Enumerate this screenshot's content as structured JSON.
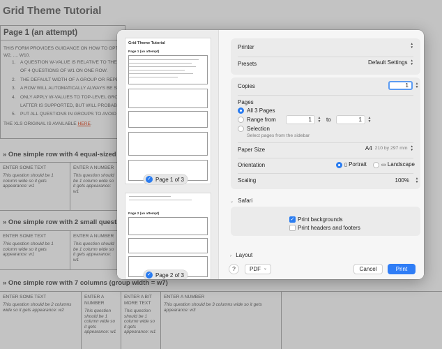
{
  "background": {
    "title": "Grid Theme Tutorial",
    "group_title": "Page 1 (an attempt)",
    "intro": "THIS FORM PROVIDES GUIDANCE ON HOW TO OPTI",
    "intro2": "W2, .... W10.",
    "list": [
      "A QUESTION W-VALUE IS RELATIVE TO THE W",
      "OF 4 QUESTIONS OF W1 ON ONE ROW.",
      "THE DEFAULT WIDTH OF A GROUP OR REPE",
      "A ROW WILL AUTOMATICALLY ALWAYS BE ST",
      "ONLY APPLY W-VALUES TO TOP-LEVEL GRO",
      "LATTER IS SUPPORTED, BUT WILL PROBABLY",
      "PUT ALL QUESTIONS IN GROUPS TO AVOID L"
    ],
    "list_numbers": [
      "1.",
      "",
      "2.",
      "3.",
      "4.",
      "",
      "5."
    ],
    "xls_prefix": "THE XLS ORIGINAL IS AVAILABLE",
    "xls_link": "HERE",
    "xls_suffix": ".",
    "sections": [
      {
        "heading": "» One simple row with 4 equal-sized que",
        "cells": [
          {
            "label": "ENTER SOME TEXT",
            "hint": "This question should be 1 column wide so it gets appearance: w1"
          },
          {
            "label": "ENTER A NUMBER",
            "hint": "This question should be 1 column wide so it gets appearance: w1"
          }
        ]
      },
      {
        "heading": "» One simple row with 2 small questions",
        "cells": [
          {
            "label": "ENTER SOME TEXT",
            "hint": "This question should be 1 column wide so it gets appearance: w1"
          },
          {
            "label": "ENTER A NUMBER",
            "hint": "This question should be 1 column wide so it gets appearance: w1"
          }
        ]
      },
      {
        "heading": "» One simple row with 7 columns (group width = w7)",
        "cells": [
          {
            "label": "ENTER SOME TEXT",
            "hint": "This question should be 2 columns wide so it gets appearance: w2"
          },
          {
            "label": "ENTER A NUMBER",
            "hint": "This question should be 1 column wide so it gets appearance: w1"
          },
          {
            "label": "ENTER A BIT MORE TEXT",
            "hint": "This question should be 1 column wide so it gets appearance: w1"
          },
          {
            "label": "ENTER A NUMBER",
            "hint": "This question should be 3 columns wide so it gets appearance: w3"
          }
        ]
      }
    ]
  },
  "print_dialog": {
    "preview": {
      "page1_badge": "Page 1 of 3",
      "page2_badge": "Page 2 of 3",
      "thumb1_title": "Grid Theme Tutorial",
      "thumb1_subtitle": "Page 1 (an attempt)",
      "thumb2_title": "Page 2 (an attempt)"
    },
    "printer_label": "Printer",
    "printer_value": "",
    "presets_label": "Presets",
    "presets_value": "Default Settings",
    "copies_label": "Copies",
    "copies_value": "1",
    "pages_label": "Pages",
    "pages_all": "All 3 Pages",
    "pages_range": "Range from",
    "range_from": "1",
    "range_to_label": "to",
    "range_to": "1",
    "pages_selection": "Selection",
    "selection_hint": "Select pages from the sidebar",
    "paper_size_label": "Paper Size",
    "paper_size_value": "A4",
    "paper_size_dims": "210 by 297 mm",
    "orientation_label": "Orientation",
    "orientation_portrait": "Portrait",
    "orientation_landscape": "Landscape",
    "scaling_label": "Scaling",
    "scaling_value": "100%",
    "safari_label": "Safari",
    "print_backgrounds": "Print backgrounds",
    "print_headers": "Print headers and footers",
    "layout_label": "Layout",
    "help_label": "?",
    "pdf_label": "PDF",
    "cancel_label": "Cancel",
    "print_label": "Print",
    "accent_color": "#2a7cf0"
  }
}
